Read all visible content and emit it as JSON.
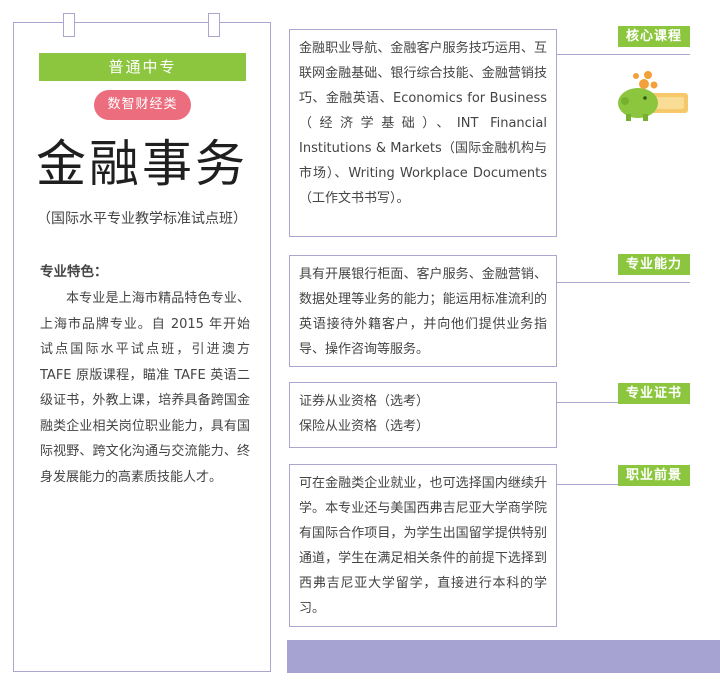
{
  "header": {
    "category": "普通中专",
    "subcategory": "数智财经类",
    "title": "金融事务",
    "subtitle": "（国际水平专业教学标准试点班）"
  },
  "features": {
    "label": "专业特色：",
    "text": "本专业是上海市精品特色专业、上海市品牌专业。自 2015 年开始试点国际水平试点班，引进澳方 TAFE 原版课程，瞄准 TAFE 英语二级证书，外教上课，培养具备跨国金融类企业相关岗位职业能力，具有国际视野、跨文化沟通与交流能力、终身发展能力的高素质技能人才。"
  },
  "sections": [
    {
      "tag": "核心课程",
      "text": "金融职业导航、金融客户服务技巧运用、互联网金融基础、银行综合技能、金融营销技巧、金融英语、Economics for Business（经济学基础）、INT Financial Institutions & Markets（国际金融机构与市场）、Writing Workplace Documents（工作文书书写）。"
    },
    {
      "tag": "专业能力",
      "text": "具有开展银行柜面、客户服务、金融营销、数据处理等业务的能力；能运用标准流利的英语接待外籍客户，并向他们提供业务指导、操作咨询等服务。"
    },
    {
      "tag": "专业证书",
      "lines": [
        "证券从业资格（选考）",
        "保险从业资格（选考）"
      ]
    },
    {
      "tag": "职业前景",
      "text": "可在金融类企业就业，也可选择国内继续升学。本专业还与美国西弗吉尼亚大学商学院有国际合作项目，为学生出国留学提供特别通道，学生在满足相关条件的前提下选择到西弗吉尼亚大学留学，直接进行本科的学习。"
    }
  ],
  "icons": {
    "illustration": "piggy-bank-coins-icon"
  },
  "colors": {
    "green": "#8cc63f",
    "pink": "#ec6e7e",
    "lavender": "#a9a6cf",
    "bar": "#a6a2d2"
  }
}
